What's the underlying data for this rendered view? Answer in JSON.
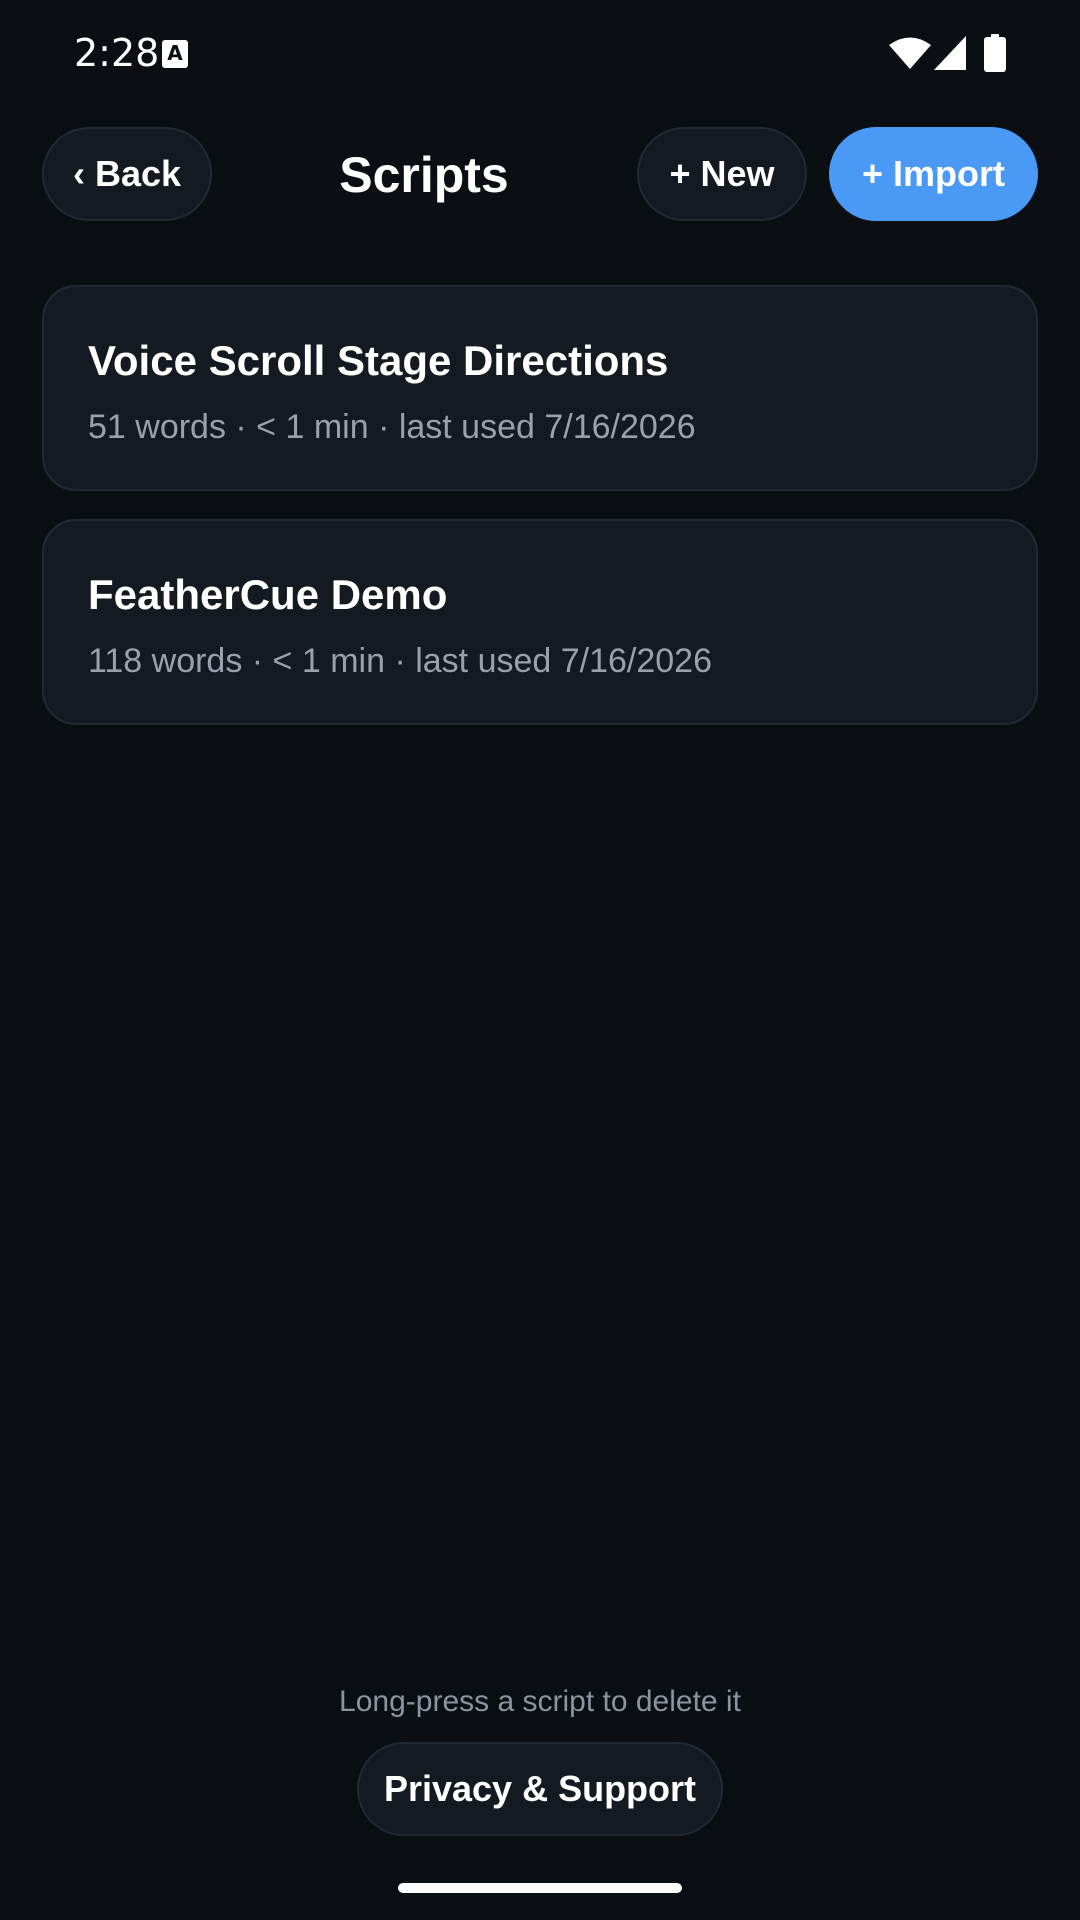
{
  "status_bar": {
    "time": "2:28",
    "notification_icon_letter": "A",
    "icons": [
      "a-notification-icon",
      "wifi-icon",
      "signal-icon",
      "battery-icon"
    ]
  },
  "header": {
    "back_label": "‹ Back",
    "title": "Scripts",
    "new_label": "+ New",
    "import_label": "+ Import"
  },
  "scripts": [
    {
      "title": "Voice Scroll Stage Directions",
      "meta": "51 words · < 1 min · last used 7/16/2026"
    },
    {
      "title": "FeatherCue Demo",
      "meta": "118 words · < 1 min · last used 7/16/2026"
    }
  ],
  "footer": {
    "hint": "Long-press a script to delete it",
    "privacy_label": "Privacy & Support"
  },
  "colors": {
    "background": "#0b0e13",
    "card": "#141922",
    "accent": "#4a9af5",
    "meta_text": "#9aa1ad"
  }
}
